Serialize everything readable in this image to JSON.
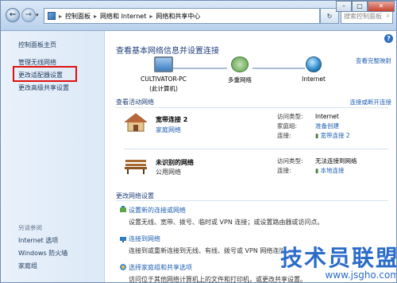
{
  "titlebar": {
    "back": "←",
    "forward": "→",
    "breadcrumbs": [
      "控制面板",
      "网络和 Internet",
      "网络和共享中心"
    ],
    "search_placeholder": "搜索控制面板",
    "refresh": "↻"
  },
  "window_controls": {
    "minimize": "–",
    "maximize": "□",
    "close": "✕"
  },
  "sidebar": {
    "items": [
      "控制面板主页",
      "管理无线网络",
      "更改适配器设置",
      "更改高级共享设置"
    ],
    "see_also": "另请参阅",
    "see_also_items": [
      "Internet 选项",
      "Windows 防火墙",
      "家庭组"
    ]
  },
  "main": {
    "title": "查看基本网络信息并设置连接",
    "full_map": "查看完整映射",
    "map": {
      "pc": "CULTIVATOR-PC",
      "pc_sub": "(此计算机)",
      "multi": "多重网络",
      "internet": "Internet"
    },
    "active_title": "查看活动网络",
    "connect_link": "连接或断开连接",
    "networks": [
      {
        "name": "宽带连接  2",
        "type": "家庭网络",
        "type_is_link": true,
        "props": [
          [
            "访问类型:",
            "Internet"
          ],
          [
            "家庭组:",
            "准备创建"
          ],
          [
            "连接:",
            "宽带连接 2"
          ]
        ]
      },
      {
        "name": "未识别的网络",
        "type": "公用网络",
        "type_is_link": false,
        "props": [
          [
            "访问类型:",
            "无法连接到网络"
          ],
          [
            "连接:",
            "本地连接"
          ]
        ]
      }
    ],
    "change_title": "更改网络设置",
    "tasks": [
      {
        "title": "设置新的连接或网络",
        "desc": "设置无线、宽带、拨号、临时或 VPN 连接；或设置路由器或访问点。"
      },
      {
        "title": "连接到网络",
        "desc": "连接到或重新连接到无线、有线、拨号或 VPN 网络连接。"
      },
      {
        "title": "选择家庭组和共享选项",
        "desc": "访问位于其他网络计算机上的文件和打印机，或更改共享设置。"
      }
    ],
    "help": "?"
  },
  "watermark": {
    "text": "技术员联盟",
    "url": "www.jsgho.com"
  }
}
